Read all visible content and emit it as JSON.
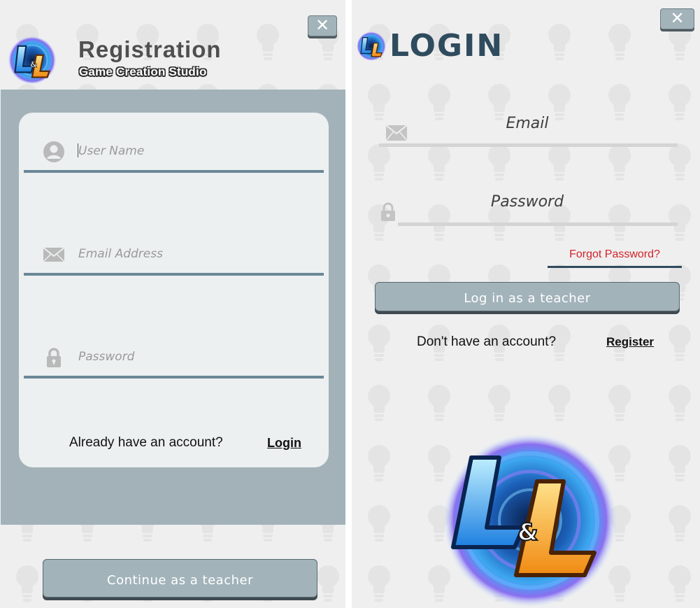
{
  "registration": {
    "title": "Registration",
    "subtitle": "Game Creation Studio",
    "logo_text": "L&L",
    "close_label": "✕",
    "fields": {
      "username": {
        "placeholder": "User Name",
        "value": "",
        "icon": "user-icon"
      },
      "email": {
        "placeholder": "Email Address",
        "value": "",
        "icon": "envelope-icon"
      },
      "password": {
        "placeholder": "Password",
        "value": "",
        "icon": "lock-icon"
      }
    },
    "footer_text": "Already have an account?",
    "login_link": "Login",
    "continue_button": "Continue as a teacher"
  },
  "login": {
    "title": "LOGIN",
    "logo_text": "L&L",
    "close_label": "✕",
    "email_label": "Email",
    "password_label": "Password",
    "forgot_password": "Forgot Password?",
    "login_button": "Log in as a teacher",
    "footer_text": "Don't have an account?",
    "register_link": "Register"
  },
  "colors": {
    "accent": "#2f4b5e",
    "field_underline": "#6b8797",
    "button": "#a2b3ba",
    "forgot_link": "#d2232a",
    "band": "#a3b2b9"
  }
}
